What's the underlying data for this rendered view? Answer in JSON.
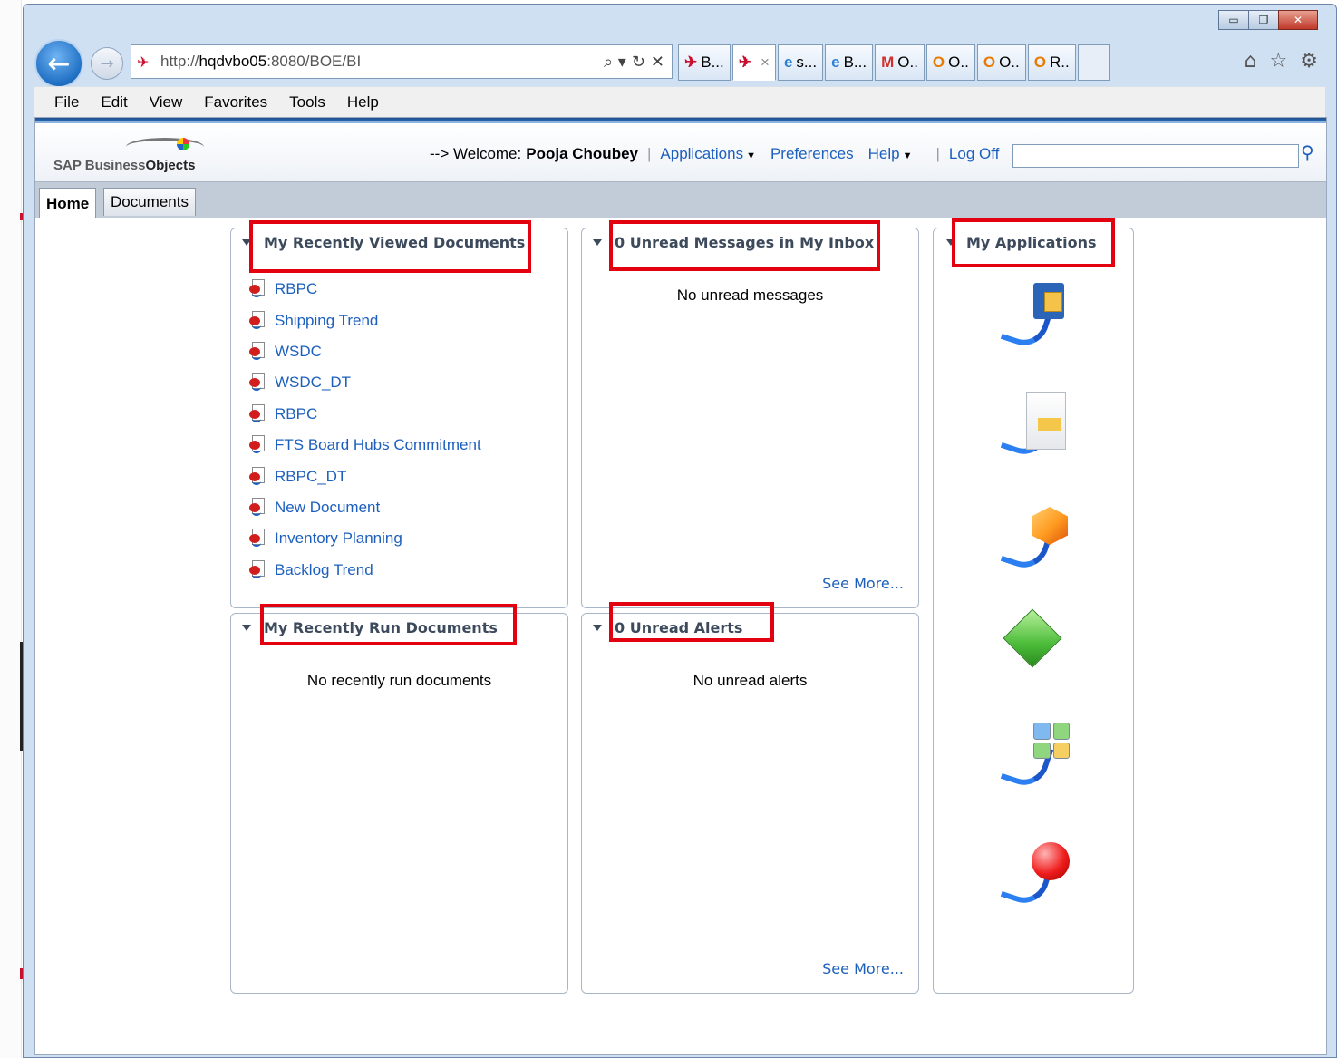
{
  "browser": {
    "address_url_prefix": "http://",
    "address_url_host": "hqdvbo05",
    "address_url_rest": ":8080/BOE/BI",
    "address_tools": [
      "⌕ ▾",
      "↻",
      "✕"
    ],
    "tabs": [
      {
        "icon": "sap-icon",
        "glyph": "✈",
        "label": "B..."
      },
      {
        "icon": "sap-icon",
        "glyph": "✈",
        "label": "",
        "close": "×",
        "active": true
      },
      {
        "icon": "ie-icon",
        "glyph": "e",
        "label": "s..."
      },
      {
        "icon": "ie-icon",
        "glyph": "e",
        "label": "B..."
      },
      {
        "icon": "gmail-icon",
        "glyph": "M",
        "label": "O.."
      },
      {
        "icon": "office-icon",
        "glyph": "O",
        "label": "O.."
      },
      {
        "icon": "office-icon",
        "glyph": "O",
        "label": "O.."
      },
      {
        "icon": "office-icon",
        "glyph": "O",
        "label": "R.."
      }
    ],
    "menu": [
      "File",
      "Edit",
      "View",
      "Favorites",
      "Tools",
      "Help"
    ]
  },
  "header": {
    "logo_part1": "SAP Business",
    "logo_part2": "Objects",
    "welcome_prefix": "--> Welcome:",
    "user_name": "Pooja Choubey",
    "applications": "Applications",
    "preferences": "Preferences",
    "help": "Help",
    "log_off": "Log Off",
    "search_value": ""
  },
  "app_tabs": [
    "Home",
    "Documents"
  ],
  "portlets": {
    "recent_viewed": {
      "title": "My Recently Viewed Documents",
      "items": [
        "RBPC",
        "Shipping Trend",
        "WSDC",
        "WSDC_DT",
        "RBPC",
        "FTS Board Hubs Commitment",
        "RBPC_DT",
        "New Document",
        "Inventory Planning",
        "Backlog Trend"
      ]
    },
    "inbox": {
      "title": "0 Unread Messages in My Inbox",
      "empty": "No unread messages",
      "see_more": "See More..."
    },
    "applications": {
      "title": "My Applications",
      "icons": [
        "bi-launchpad-folder-icon",
        "report-document-icon",
        "analysis-cube-icon",
        "explorer-diamond-icon",
        "dashboard-grid-icon",
        "alert-ball-icon"
      ]
    },
    "recent_run": {
      "title": "My Recently Run Documents",
      "empty": "No recently run documents"
    },
    "alerts": {
      "title": "0 Unread Alerts",
      "empty": "No unread alerts",
      "see_more": "See More..."
    }
  },
  "colors": {
    "highlight_box": "#e3000f",
    "link": "#1c5fbd"
  }
}
